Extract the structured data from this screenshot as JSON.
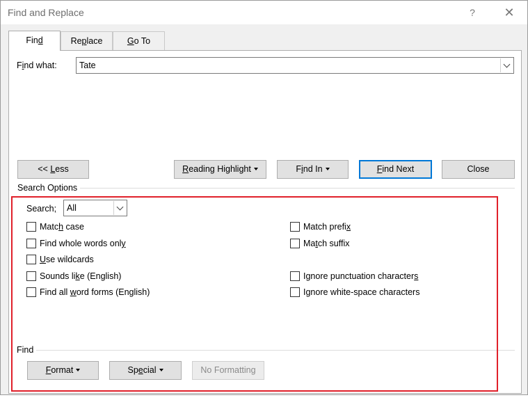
{
  "window": {
    "title": "Find and Replace",
    "help_glyph": "?",
    "close_glyph": "✕"
  },
  "tabs": [
    {
      "label": "Find",
      "active": true
    },
    {
      "label": "Replace",
      "active": false
    },
    {
      "label": "Go To",
      "active": false
    }
  ],
  "find_what": {
    "label": "Find what:",
    "value": "Tate"
  },
  "buttons": {
    "less": "<< Less",
    "reading_highlight": "Reading Highlight",
    "find_in": "Find In",
    "find_next": "Find Next",
    "close": "Close"
  },
  "search_options": {
    "title": "Search Options",
    "search_label": "Search:",
    "search_value": "All",
    "checkboxes_left": [
      {
        "label": "Match case",
        "checked": false
      },
      {
        "label": "Find whole words only",
        "checked": false
      },
      {
        "label": "Use wildcards",
        "checked": false
      },
      {
        "label": "Sounds like (English)",
        "checked": false
      },
      {
        "label": "Find all word forms (English)",
        "checked": false
      }
    ],
    "checkboxes_right": [
      {
        "label": "Match prefix",
        "checked": false
      },
      {
        "label": "Match suffix",
        "checked": false
      },
      {
        "label": "Ignore punctuation characters",
        "checked": false
      },
      {
        "label": "Ignore white-space characters",
        "checked": false
      }
    ]
  },
  "find_section": {
    "title": "Find",
    "format": "Format",
    "special": "Special",
    "no_formatting": "No Formatting"
  },
  "colors": {
    "accent": "#0078d7",
    "annotation": "#e0202a",
    "dialog_bg": "#f0f0f0"
  }
}
